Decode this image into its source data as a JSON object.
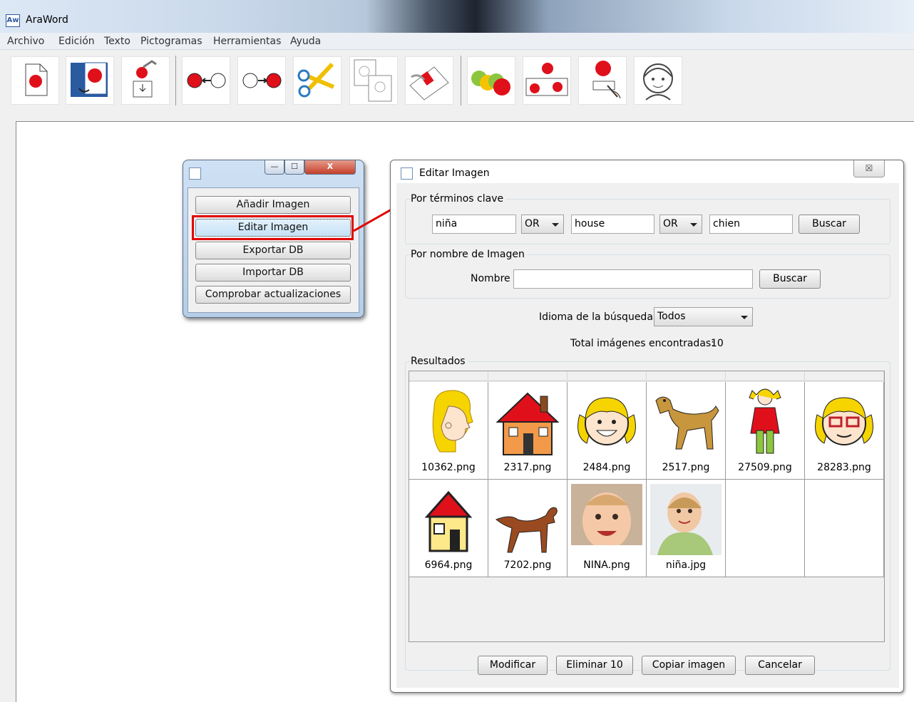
{
  "app": {
    "title": "AraWord",
    "icon_text": "Aw"
  },
  "menu": [
    "Archivo",
    "Edición",
    "Texto",
    "Pictogramas",
    "Herramientas",
    "Ayuda"
  ],
  "toolbar": [
    "new-document-icon",
    "open-document-icon",
    "save-icon",
    "arrow-left-icon",
    "arrow-right-icon",
    "cut-icon",
    "copy-icon",
    "paste-icon",
    "apples-icon",
    "apples-table-icon",
    "apple-writing-icon",
    "face-icon"
  ],
  "small_dialog": {
    "buttons": [
      "Añadir Imagen",
      "Editar Imagen",
      "Exportar DB",
      "Importar DB",
      "Comprobar actualizaciones"
    ],
    "selected_index": 1,
    "controls": {
      "minimize": "—",
      "maximize": "☐",
      "close": "X"
    }
  },
  "edit_dialog": {
    "title": "Editar Imagen",
    "close_label": "☒",
    "keywords_group": {
      "label": "Por términos clave",
      "term1": "niña",
      "op1": "OR",
      "term2": "house",
      "op2": "OR",
      "term3": "chien",
      "search_label": "Buscar"
    },
    "name_group": {
      "label": "Por nombre de Imagen",
      "name_label": "Nombre",
      "name_value": "",
      "search_label": "Buscar"
    },
    "language": {
      "label": "Idioma de la búsqueda:",
      "value": "Todos"
    },
    "total": {
      "label": "Total imágenes encontradas:",
      "value": "10"
    },
    "results": {
      "label": "Resultados",
      "items": [
        "10362.png",
        "2317.png",
        "2484.png",
        "2517.png",
        "27509.png",
        "28283.png",
        "6964.png",
        "7202.png",
        "NINA.png",
        "niña.jpg"
      ]
    },
    "buttons": {
      "modify": "Modificar",
      "delete": "Eliminar 10",
      "copy": "Copiar imagen",
      "cancel": "Cancelar"
    }
  },
  "colors": {
    "highlight": "#e00000",
    "red": "#e0101b",
    "blond": "#f5d400"
  }
}
